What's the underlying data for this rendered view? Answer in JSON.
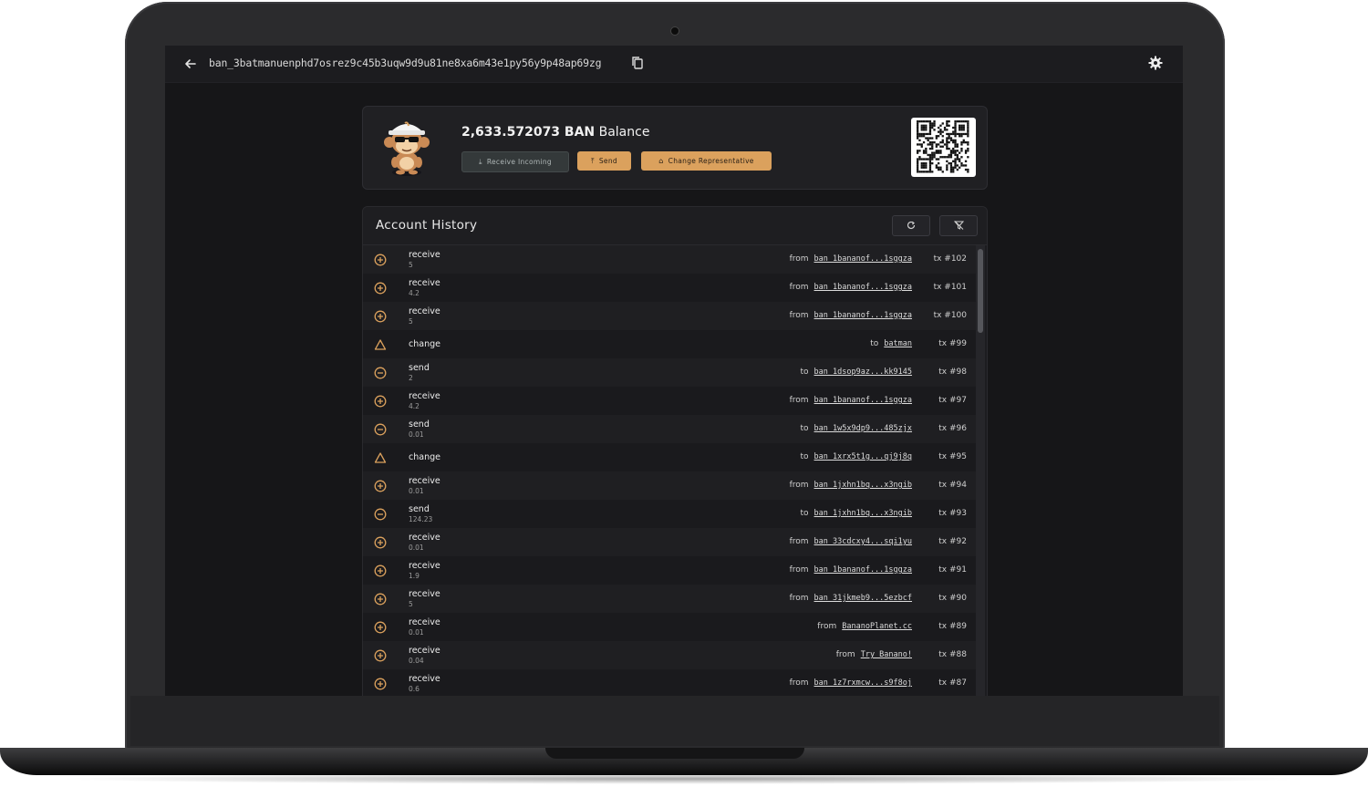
{
  "topbar": {
    "back_icon": "arrow-left-icon",
    "address": "ban_3batmanuenphd7osrez9c45b3uqw9d9u81ne8xa6m43e1py56y9p48ap69zg",
    "copy_icon": "copy-icon",
    "settings_icon": "gear-icon"
  },
  "balance": {
    "amount": "2,633.572073 BAN",
    "label": "Balance",
    "buttons": {
      "receive": "Receive Incoming",
      "send": "Send",
      "change_rep": "Change Representative"
    }
  },
  "history": {
    "title": "Account History",
    "refresh_icon": "refresh-icon",
    "filter_icon": "filter-off-icon",
    "rows": [
      {
        "type": "receive",
        "amount": "5",
        "dir": "from",
        "addr": "ban_1bananof...1sggza",
        "tx": "tx #102"
      },
      {
        "type": "receive",
        "amount": "4.2",
        "dir": "from",
        "addr": "ban_1bananof...1sggza",
        "tx": "tx #101"
      },
      {
        "type": "receive",
        "amount": "5",
        "dir": "from",
        "addr": "ban_1bananof...1sggza",
        "tx": "tx #100"
      },
      {
        "type": "change",
        "amount": "",
        "dir": "to",
        "addr": "batman",
        "tx": "tx #99"
      },
      {
        "type": "send",
        "amount": "2",
        "dir": "to",
        "addr": "ban_1dsop9az...kk9145",
        "tx": "tx #98"
      },
      {
        "type": "receive",
        "amount": "4.2",
        "dir": "from",
        "addr": "ban_1bananof...1sggza",
        "tx": "tx #97"
      },
      {
        "type": "send",
        "amount": "0.01",
        "dir": "to",
        "addr": "ban_1w5x9dp9...485zjx",
        "tx": "tx #96"
      },
      {
        "type": "change",
        "amount": "",
        "dir": "to",
        "addr": "ban_1xrx5t1g...qj9j8q",
        "tx": "tx #95"
      },
      {
        "type": "receive",
        "amount": "0.01",
        "dir": "from",
        "addr": "ban_1jxhn1bq...x3ngib",
        "tx": "tx #94"
      },
      {
        "type": "send",
        "amount": "124.23",
        "dir": "to",
        "addr": "ban_1jxhn1bq...x3ngib",
        "tx": "tx #93"
      },
      {
        "type": "receive",
        "amount": "0.01",
        "dir": "from",
        "addr": "ban_33cdcxy4...sqi1yu",
        "tx": "tx #92"
      },
      {
        "type": "receive",
        "amount": "1.9",
        "dir": "from",
        "addr": "ban_1bananof...1sggza",
        "tx": "tx #91"
      },
      {
        "type": "receive",
        "amount": "5",
        "dir": "from",
        "addr": "ban_31jkmeb9...5ezbcf",
        "tx": "tx #90"
      },
      {
        "type": "receive",
        "amount": "0.01",
        "dir": "from",
        "addr": "BananoPlanet.cc",
        "tx": "tx #89"
      },
      {
        "type": "receive",
        "amount": "0.04",
        "dir": "from",
        "addr": "Try Banano!",
        "tx": "tx #88"
      },
      {
        "type": "receive",
        "amount": "0.6",
        "dir": "from",
        "addr": "ban_1z7rxmcw...s9f8oj",
        "tx": "tx #87"
      }
    ]
  },
  "colors": {
    "accent": "#dba15d",
    "background": "#161618",
    "card": "#202023"
  }
}
